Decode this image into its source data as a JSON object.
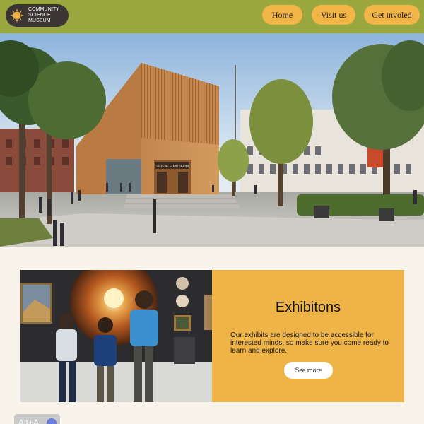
{
  "header": {
    "logo": {
      "lines": [
        "COMMUNITY",
        "SCIENCE",
        "MUSEUM"
      ],
      "icon": "sun-icon"
    },
    "nav": {
      "home": "Home",
      "visit": "Visit us",
      "involved": "Get involed"
    }
  },
  "hero": {
    "building_sign": "SCIENCE MUSEUM"
  },
  "exhibitions": {
    "title": "Exhibitons",
    "description": "Our exhibits are designed to be accessible for interested minds, so make sure you come ready to learn and explore.",
    "button": "See more"
  },
  "chip": {
    "label": "Alt+A"
  },
  "colors": {
    "header_bg": "#9aa63e",
    "button_bg": "#f2b548",
    "card_panel": "#efb448",
    "page_bg": "#f8f4ec",
    "logo_bg": "#3b3635"
  }
}
